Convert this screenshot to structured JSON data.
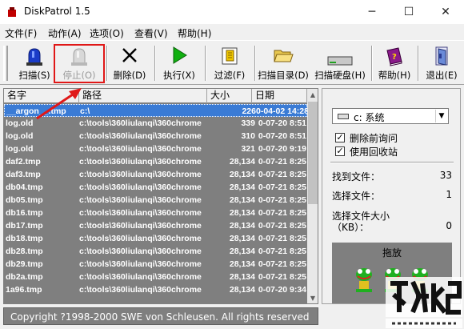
{
  "window": {
    "title": "DiskPatrol 1.5",
    "minimize_glyph": "─",
    "maximize_glyph": "☐",
    "close_glyph": "✕"
  },
  "menu": [
    "文件(F)",
    "动作(A)",
    "选项(O)",
    "查看(V)",
    "帮助(H)"
  ],
  "toolbar": {
    "scan": "扫描(S)",
    "stop": "停止(O)",
    "delete": "删除(D)",
    "execute": "执行(X)",
    "filter": "过滤(F)",
    "scan_dir": "扫描目录(D)",
    "scan_disk": "扫描硬盘(H)",
    "help": "帮助(H)",
    "exit": "退出(E)"
  },
  "list": {
    "headers": {
      "name": "名字",
      "path": "路径",
      "size": "大小",
      "date": "日期"
    },
    "rows": [
      {
        "name": "__argon__.tmp",
        "path": "c:\\",
        "size": "226",
        "date": "0-04-02 14:28"
      },
      {
        "name": "log.old",
        "path": "c:\\tools\\360liulanqi\\360chrome",
        "size": "339",
        "date": "0-07-20 8:51"
      },
      {
        "name": "log.old",
        "path": "c:\\tools\\360liulanqi\\360chrome",
        "size": "310",
        "date": "0-07-20 8:51"
      },
      {
        "name": "log.old",
        "path": "c:\\tools\\360liulanqi\\360chrome",
        "size": "321",
        "date": "0-07-20 9:19"
      },
      {
        "name": "daf2.tmp",
        "path": "c:\\tools\\360liulanqi\\360chrome",
        "size": "28,134",
        "date": "0-07-21 8:25"
      },
      {
        "name": "daf3.tmp",
        "path": "c:\\tools\\360liulanqi\\360chrome",
        "size": "28,134",
        "date": "0-07-21 8:25"
      },
      {
        "name": "db04.tmp",
        "path": "c:\\tools\\360liulanqi\\360chrome",
        "size": "28,134",
        "date": "0-07-21 8:25"
      },
      {
        "name": "db05.tmp",
        "path": "c:\\tools\\360liulanqi\\360chrome",
        "size": "28,134",
        "date": "0-07-21 8:25"
      },
      {
        "name": "db16.tmp",
        "path": "c:\\tools\\360liulanqi\\360chrome",
        "size": "28,134",
        "date": "0-07-21 8:25"
      },
      {
        "name": "db17.tmp",
        "path": "c:\\tools\\360liulanqi\\360chrome",
        "size": "28,134",
        "date": "0-07-21 8:25"
      },
      {
        "name": "db18.tmp",
        "path": "c:\\tools\\360liulanqi\\360chrome",
        "size": "28,134",
        "date": "0-07-21 8:25"
      },
      {
        "name": "db28.tmp",
        "path": "c:\\tools\\360liulanqi\\360chrome",
        "size": "28,134",
        "date": "0-07-21 8:25"
      },
      {
        "name": "db29.tmp",
        "path": "c:\\tools\\360liulanqi\\360chrome",
        "size": "28,134",
        "date": "0-07-21 8:25"
      },
      {
        "name": "db2a.tmp",
        "path": "c:\\tools\\360liulanqi\\360chrome",
        "size": "28,134",
        "date": "0-07-21 8:25"
      },
      {
        "name": "1a96.tmp",
        "path": "c:\\tools\\360liulanqi\\360chrome",
        "size": "28,134",
        "date": "0-07-20 9:34"
      }
    ]
  },
  "right_panel": {
    "drive": "c: 系统",
    "confirm_delete": "删除前询问",
    "use_recycle_bin": "使用回收站",
    "files_found_label": "找到文件：",
    "files_found_value": "33",
    "files_selected_label": "选择文件：",
    "files_selected_value": "1",
    "selected_size_label_1": "选择文件大小",
    "selected_size_label_2": "（KB）：",
    "selected_size_value": "0",
    "drop_label": "拖放"
  },
  "status": "Copyright ?1998-2000 SWE von Schleusen. All rights reserved",
  "colors": {
    "list_bg": "#7f7f7f",
    "selection": "#3a7bd5",
    "highlight": "#e01818"
  }
}
